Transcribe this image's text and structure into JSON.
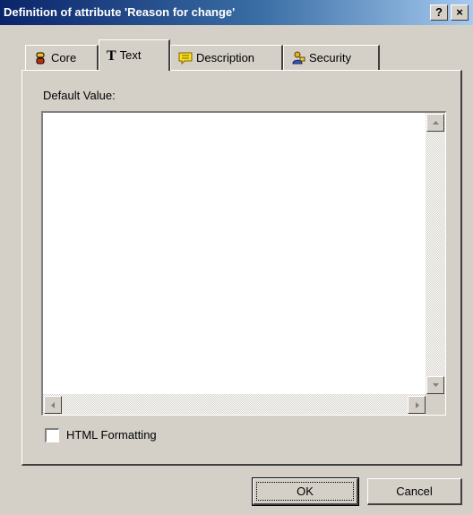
{
  "window": {
    "title": "Definition of attribute 'Reason for change'",
    "help_label": "?",
    "close_label": "×"
  },
  "tabs": [
    {
      "label": "Core",
      "icon": "core-icon",
      "active": false
    },
    {
      "label": "Text",
      "icon": "T",
      "active": true
    },
    {
      "label": "Description",
      "icon": "description-icon",
      "active": false
    },
    {
      "label": "Security",
      "icon": "security-icon",
      "active": false
    }
  ],
  "text_tab": {
    "default_value_label": "Default Value:",
    "default_value": "",
    "html_formatting_label": "HTML Formatting",
    "html_formatting_checked": false
  },
  "buttons": {
    "ok": "OK",
    "cancel": "Cancel"
  },
  "colors": {
    "face": "#d4d0c8",
    "title_start": "#0a246a",
    "title_end": "#a6caf0"
  }
}
